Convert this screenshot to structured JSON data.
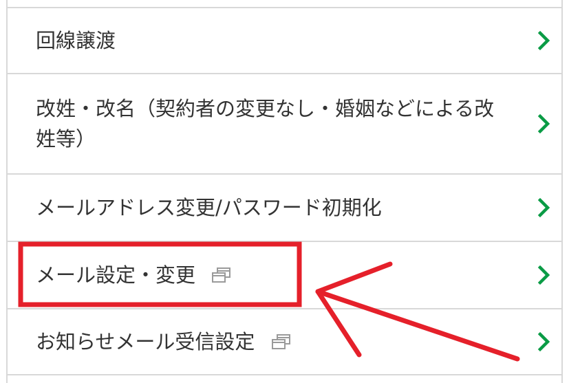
{
  "menu": {
    "items": [
      {
        "label": "回線譲渡",
        "external": false
      },
      {
        "label": "改姓・改名（契約者の変更なし・婚姻などによる改姓等）",
        "external": false
      },
      {
        "label": "メールアドレス変更/パスワード初期化",
        "external": false
      },
      {
        "label": "メール設定・変更",
        "external": true
      },
      {
        "label": "お知らせメール受信設定",
        "external": true
      }
    ],
    "icons": {
      "chevron": "chevron-right-icon",
      "external": "new-window-icon"
    }
  },
  "colors": {
    "text": "#333333",
    "divider": "#d8d8d8",
    "chevron": "#0a9b45",
    "icon_gray": "#9a9a9a",
    "annotation_red": "#e5202a"
  }
}
